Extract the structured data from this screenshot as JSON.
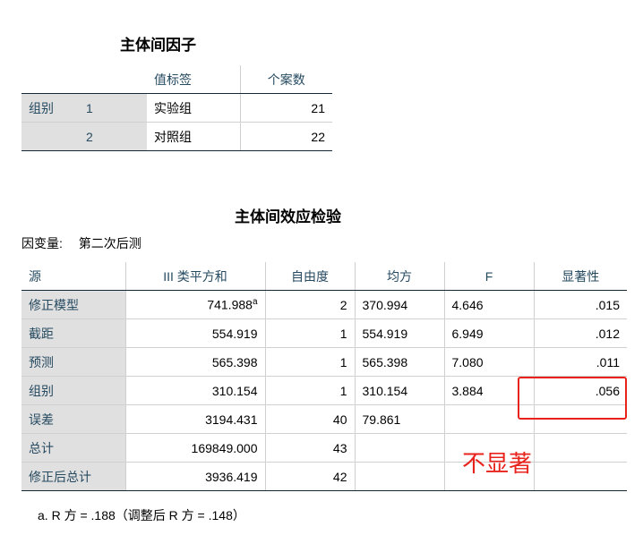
{
  "table1": {
    "title": "主体间因子",
    "headers": [
      "值标签",
      "个案数"
    ],
    "group_label": "组别",
    "rows": [
      {
        "code": "1",
        "value_label": "实验组",
        "n": "21"
      },
      {
        "code": "2",
        "value_label": "对照组",
        "n": "22"
      }
    ]
  },
  "table2": {
    "title": "主体间效应检验",
    "dependent_label": "因变量:",
    "dependent_value": "第二次后测",
    "headers": [
      "源",
      "III 类平方和",
      "自由度",
      "均方",
      "F",
      "显著性"
    ],
    "rows": [
      {
        "source": "修正模型",
        "ss": "741.988",
        "sup": "a",
        "df": "2",
        "ms": "370.994",
        "f": "4.646",
        "sig": ".015"
      },
      {
        "source": "截距",
        "ss": "554.919",
        "df": "1",
        "ms": "554.919",
        "f": "6.949",
        "sig": ".012"
      },
      {
        "source": "预测",
        "ss": "565.398",
        "df": "1",
        "ms": "565.398",
        "f": "7.080",
        "sig": ".011"
      },
      {
        "source": "组别",
        "ss": "310.154",
        "df": "1",
        "ms": "310.154",
        "f": "3.884",
        "sig": ".056"
      },
      {
        "source": "误差",
        "ss": "3194.431",
        "df": "40",
        "ms": "79.861",
        "f": "",
        "sig": ""
      },
      {
        "source": "总计",
        "ss": "169849.000",
        "df": "43",
        "ms": "",
        "f": "",
        "sig": ""
      },
      {
        "source": "修正后总计",
        "ss": "3936.419",
        "df": "42",
        "ms": "",
        "f": "",
        "sig": ""
      }
    ],
    "footnote": "a. R 方 = .188（调整后 R 方 = .148）"
  },
  "annotation": {
    "text": "不显著",
    "color": "#e8231c"
  }
}
